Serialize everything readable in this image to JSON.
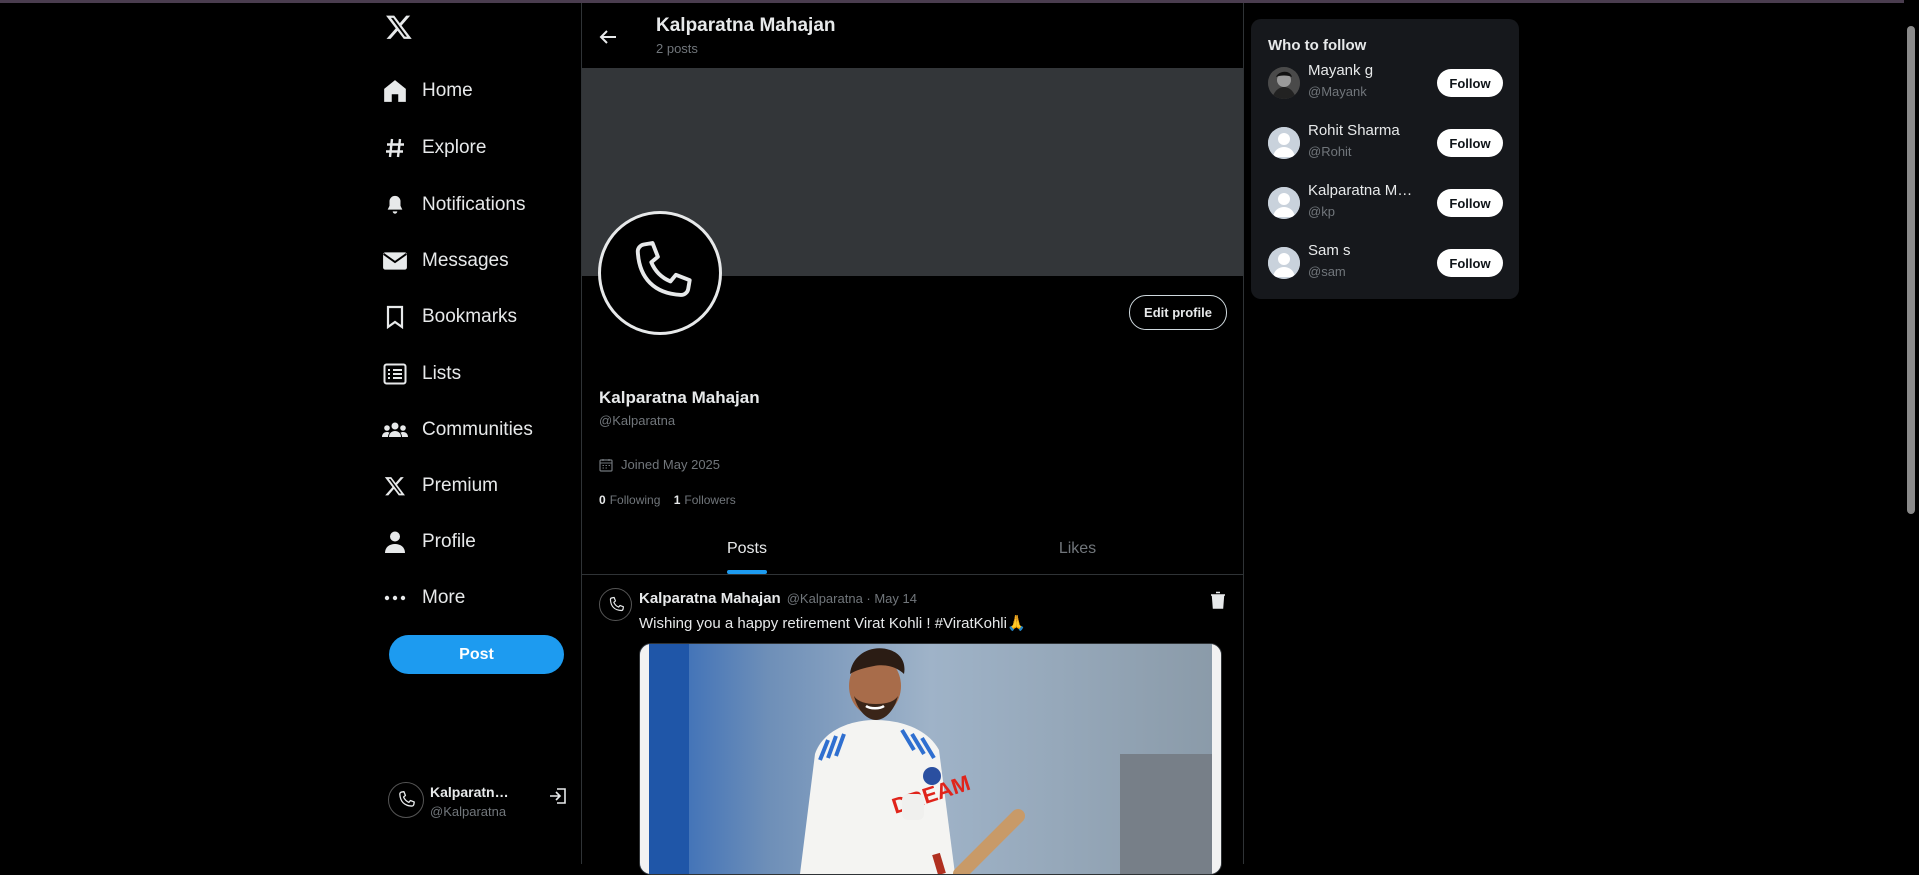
{
  "nav": {
    "logo": "x-logo",
    "items": [
      {
        "label": "Home",
        "icon": "home-icon"
      },
      {
        "label": "Explore",
        "icon": "hashtag-icon"
      },
      {
        "label": "Notifications",
        "icon": "bell-icon"
      },
      {
        "label": "Messages",
        "icon": "envelope-icon"
      },
      {
        "label": "Bookmarks",
        "icon": "bookmark-icon"
      },
      {
        "label": "Lists",
        "icon": "list-icon"
      },
      {
        "label": "Communities",
        "icon": "people-icon"
      },
      {
        "label": "Premium",
        "icon": "x-icon"
      },
      {
        "label": "Profile",
        "icon": "person-icon"
      },
      {
        "label": "More",
        "icon": "more-icon"
      }
    ],
    "post_label": "Post",
    "account": {
      "name": "Kalparatna Mahajan",
      "handle": "@Kalparatna"
    }
  },
  "header": {
    "title": "Kalparatna Mahajan",
    "subtitle": "2 posts"
  },
  "profile": {
    "edit_label": "Edit profile",
    "name": "Kalparatna Mahajan",
    "handle": "@Kalparatna",
    "joined": "Joined May 2025",
    "following_count": "0",
    "following_label": "Following",
    "followers_count": "1",
    "followers_label": "Followers"
  },
  "tabs": [
    {
      "label": "Posts",
      "active": true
    },
    {
      "label": "Likes",
      "active": false
    }
  ],
  "post": {
    "author": "Kalparatna Mahajan",
    "meta": "@Kalparatna · May 14",
    "text": "Wishing you a happy retirement Virat Kohli ! #ViratKohli🙏",
    "jersey_text": "DREAM"
  },
  "who_to_follow": {
    "title": "Who to follow",
    "follow_label": "Follow",
    "users": [
      {
        "name": "Mayank g",
        "handle": "@Mayank"
      },
      {
        "name": "Rohit Sharma",
        "handle": "@Rohit"
      },
      {
        "name": "Kalparatna Mahajan",
        "handle": "@kp"
      },
      {
        "name": "Sam s",
        "handle": "@sam"
      }
    ]
  },
  "colors": {
    "accent": "#1d9bf0",
    "background": "#000000",
    "muted": "#71767b",
    "banner": "#333639"
  }
}
